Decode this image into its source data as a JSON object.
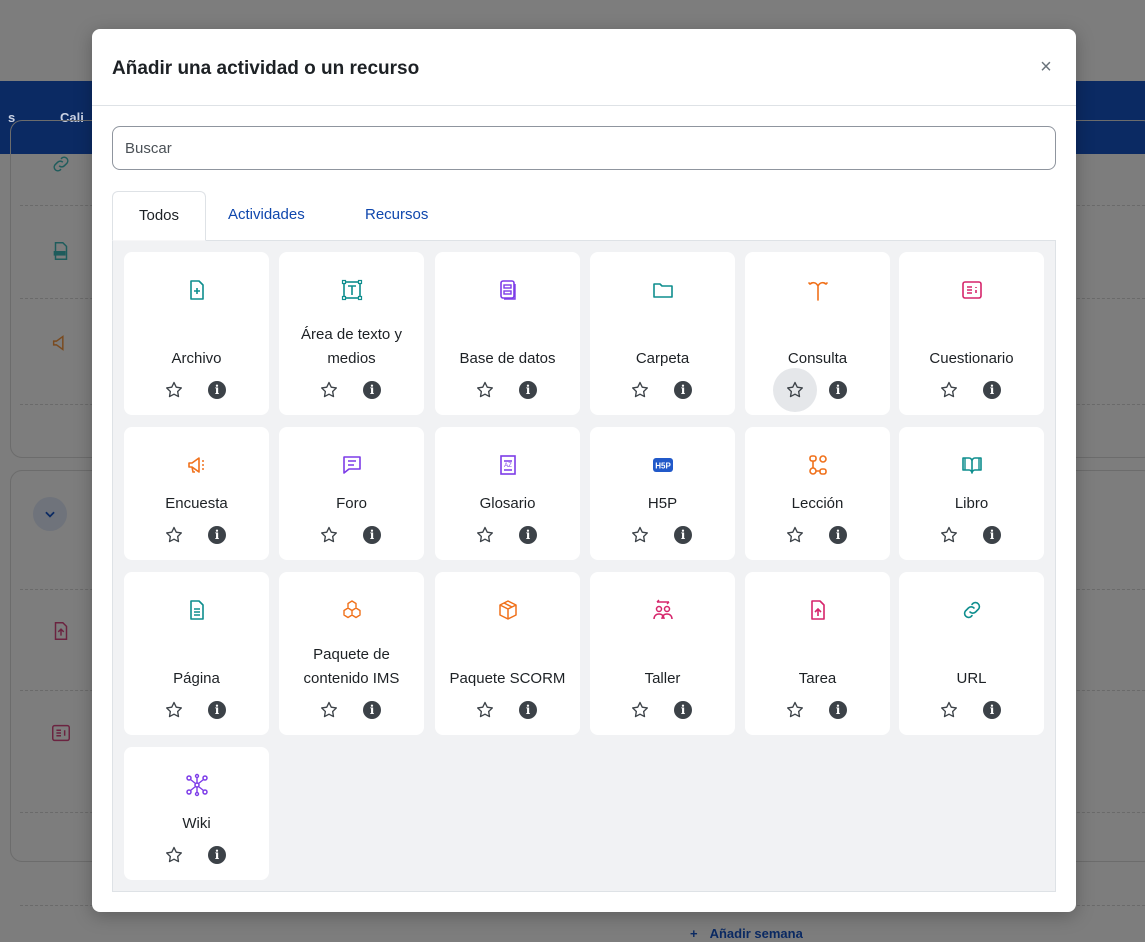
{
  "background": {
    "nav_items": [
      "s",
      "Cali"
    ],
    "add_week_plus": "+",
    "add_week_label": "Añadir semana"
  },
  "modal": {
    "title": "Añadir una actividad o un recurso",
    "close_glyph": "×",
    "search_placeholder": "Buscar",
    "tabs": [
      {
        "label": "Todos",
        "active": true
      },
      {
        "label": "Actividades",
        "active": false
      },
      {
        "label": "Recursos",
        "active": false
      }
    ],
    "star_glyph": "☆",
    "info_glyph": "i",
    "items": [
      {
        "label": "Archivo",
        "icon": "file-plus-icon",
        "color": "#0e8e8e"
      },
      {
        "label": "Área de texto y medios",
        "icon": "text-box-icon",
        "color": "#0e8e8e"
      },
      {
        "label": "Base de datos",
        "icon": "database-icon",
        "color": "#7d3ce8"
      },
      {
        "label": "Carpeta",
        "icon": "folder-icon",
        "color": "#0e8e8e"
      },
      {
        "label": "Consulta",
        "icon": "choice-signpost-icon",
        "color": "#f0711b"
      },
      {
        "label": "Cuestionario",
        "icon": "quiz-icon",
        "color": "#d6256b"
      },
      {
        "label": "Encuesta",
        "icon": "megaphone-icon",
        "color": "#f0711b"
      },
      {
        "label": "Foro",
        "icon": "forum-bubble-icon",
        "color": "#7d3ce8"
      },
      {
        "label": "Glosario",
        "icon": "glossary-book-icon",
        "color": "#7d3ce8"
      },
      {
        "label": "H5P",
        "icon": "h5p-icon",
        "color": "#2159c9"
      },
      {
        "label": "Lección",
        "icon": "lesson-flow-icon",
        "color": "#f0711b"
      },
      {
        "label": "Libro",
        "icon": "book-open-icon",
        "color": "#0e8e8e"
      },
      {
        "label": "Página",
        "icon": "page-icon",
        "color": "#0e8e8e"
      },
      {
        "label": "Paquete de contenido IMS",
        "icon": "ims-package-icon",
        "color": "#f0711b"
      },
      {
        "label": "Paquete SCORM",
        "icon": "scorm-package-icon",
        "color": "#f0711b"
      },
      {
        "label": "Taller",
        "icon": "workshop-people-icon",
        "color": "#d6256b"
      },
      {
        "label": "Tarea",
        "icon": "assignment-upload-icon",
        "color": "#d6256b"
      },
      {
        "label": "URL",
        "icon": "link-icon",
        "color": "#0e8e8e"
      },
      {
        "label": "Wiki",
        "icon": "wiki-network-icon",
        "color": "#7d3ce8"
      }
    ]
  }
}
